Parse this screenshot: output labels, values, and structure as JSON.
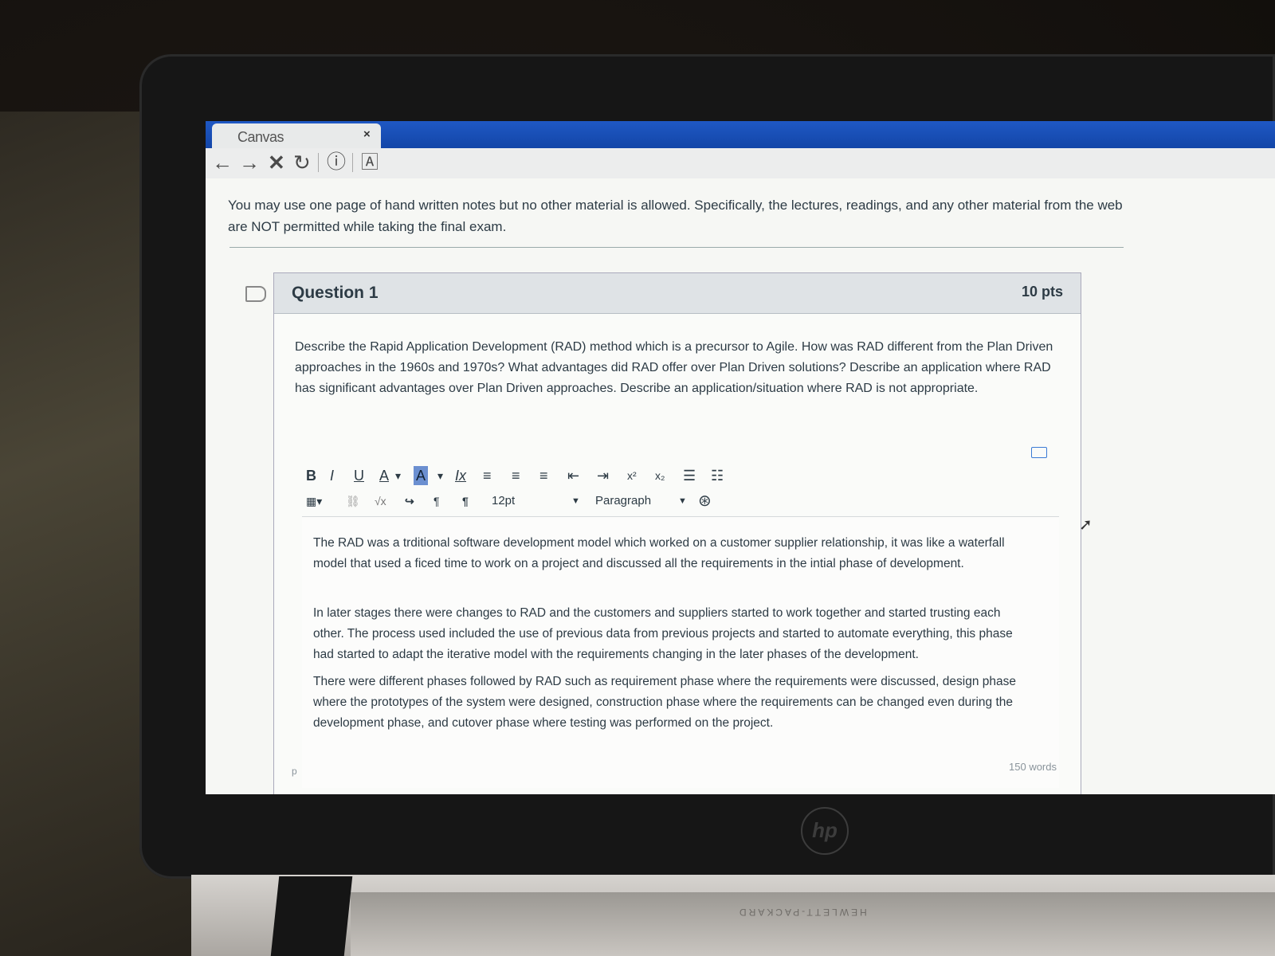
{
  "browser": {
    "tab_title": "Canvas",
    "tab_close": "×",
    "nav": {
      "back": "←",
      "forward": "→",
      "stop": "✕",
      "reload": "↻",
      "info": "ⓘ",
      "reader": "🄰"
    }
  },
  "exam": {
    "notice": "You may use one page of hand written notes but no other material is allowed.  Specifically, the lectures, readings, and any other material from the web are NOT permitted while taking the final exam."
  },
  "question": {
    "title": "Question 1",
    "points": "10 pts",
    "prompt": "Describe the Rapid Application Development (RAD) method which is a precursor to Agile.  How was RAD different from the Plan Driven approaches in the 1960s and 1970s? What advantages did RAD offer over Plan Driven solutions? Describe an application where RAD has significant advantages over Plan Driven approaches.  Describe an application/situation where RAD is not appropriate."
  },
  "editor": {
    "toolbar_row1": [
      "B",
      "I",
      "U",
      "A",
      "▾",
      "A",
      "▾",
      "Ix",
      "≡",
      "≡",
      "≡",
      "⇤",
      "⇥",
      "x²",
      "x₂",
      "☰",
      "☷"
    ],
    "toolbar_row2_icons": [
      "▦▾",
      "⛓",
      "√x",
      "↪",
      "¶",
      "¶"
    ],
    "font_size": "12pt",
    "block_format": "Paragraph",
    "paragraphs": [
      "The RAD was a trditional software development model which worked on a customer supplier relationship, it was like a waterfall model that used a ficed time to work on a project and discussed all the requirements in the intial phase of development.",
      "In later stages there were changes to RAD and the customers and suppliers started to work together and started trusting each other. The process used included the use of previous data from previous projects and started to automate everything, this phase had started to adapt the iterative model with the requirements changing in the later phases of the development.",
      "There were different phases followed by RAD such as requirement phase where the requirements were discussed, design phase where the prototypes of the system were designed, construction phase where the requirements can be changed even during the development phase, and cutover phase where testing was performed on the project."
    ],
    "path": "p",
    "word_count": "150 words"
  },
  "device": {
    "logo": "hp",
    "brand": "HEWLETT-PACKARD"
  }
}
